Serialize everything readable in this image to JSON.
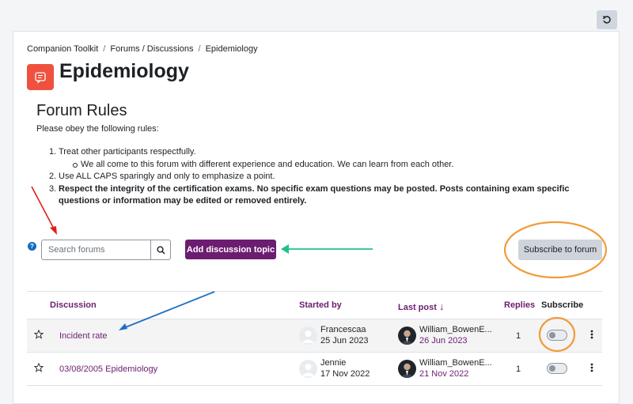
{
  "breadcrumb": [
    "Companion Toolkit",
    "Forums / Discussions",
    "Epidemiology"
  ],
  "page": {
    "title": "Epidemiology"
  },
  "rules": {
    "title": "Forum Rules",
    "intro": "Please obey the following rules:",
    "items": [
      {
        "num": "1.",
        "text": "Treat other participants respectfully."
      },
      {
        "sub": "We all come to this forum with different experience and education. We can learn from each other."
      },
      {
        "num": "2.",
        "text": "Use ALL CAPS sparingly and only to emphasize a point."
      },
      {
        "num": "3.",
        "text_bold": "Respect the integrity of the certification exams. No specific exam questions may be posted. Posts containing exam specific questions or information may be edited or removed entirely."
      }
    ]
  },
  "toolbar": {
    "search_placeholder": "Search forums",
    "add_label": "Add discussion topic",
    "subscribe_label": "Subscribe to forum",
    "help_glyph": "?"
  },
  "table": {
    "headers": {
      "discussion": "Discussion",
      "started_by": "Started by",
      "last_post": "Last post",
      "sort_arrow": "↓",
      "replies": "Replies",
      "subscribe": "Subscribe"
    },
    "rows": [
      {
        "title": "Incident rate",
        "starter": "Francescaa",
        "start_date": "25 Jun 2023",
        "last_user": "William_BowenE...",
        "last_date": "26 Jun 2023",
        "replies": "1"
      },
      {
        "title": "03/08/2005 Epidemiology",
        "starter": "Jennie",
        "start_date": "17 Nov 2022",
        "last_user": "William_BowenE...",
        "last_date": "21 Nov 2022",
        "replies": "1"
      }
    ]
  },
  "colors": {
    "brand": "#6c1d70",
    "forum_icon": "#f0513f",
    "arrow_red": "#e0201b",
    "arrow_green": "#22c08a",
    "arrow_blue": "#1f6fc4",
    "highlight_orange": "#f39a3a"
  }
}
